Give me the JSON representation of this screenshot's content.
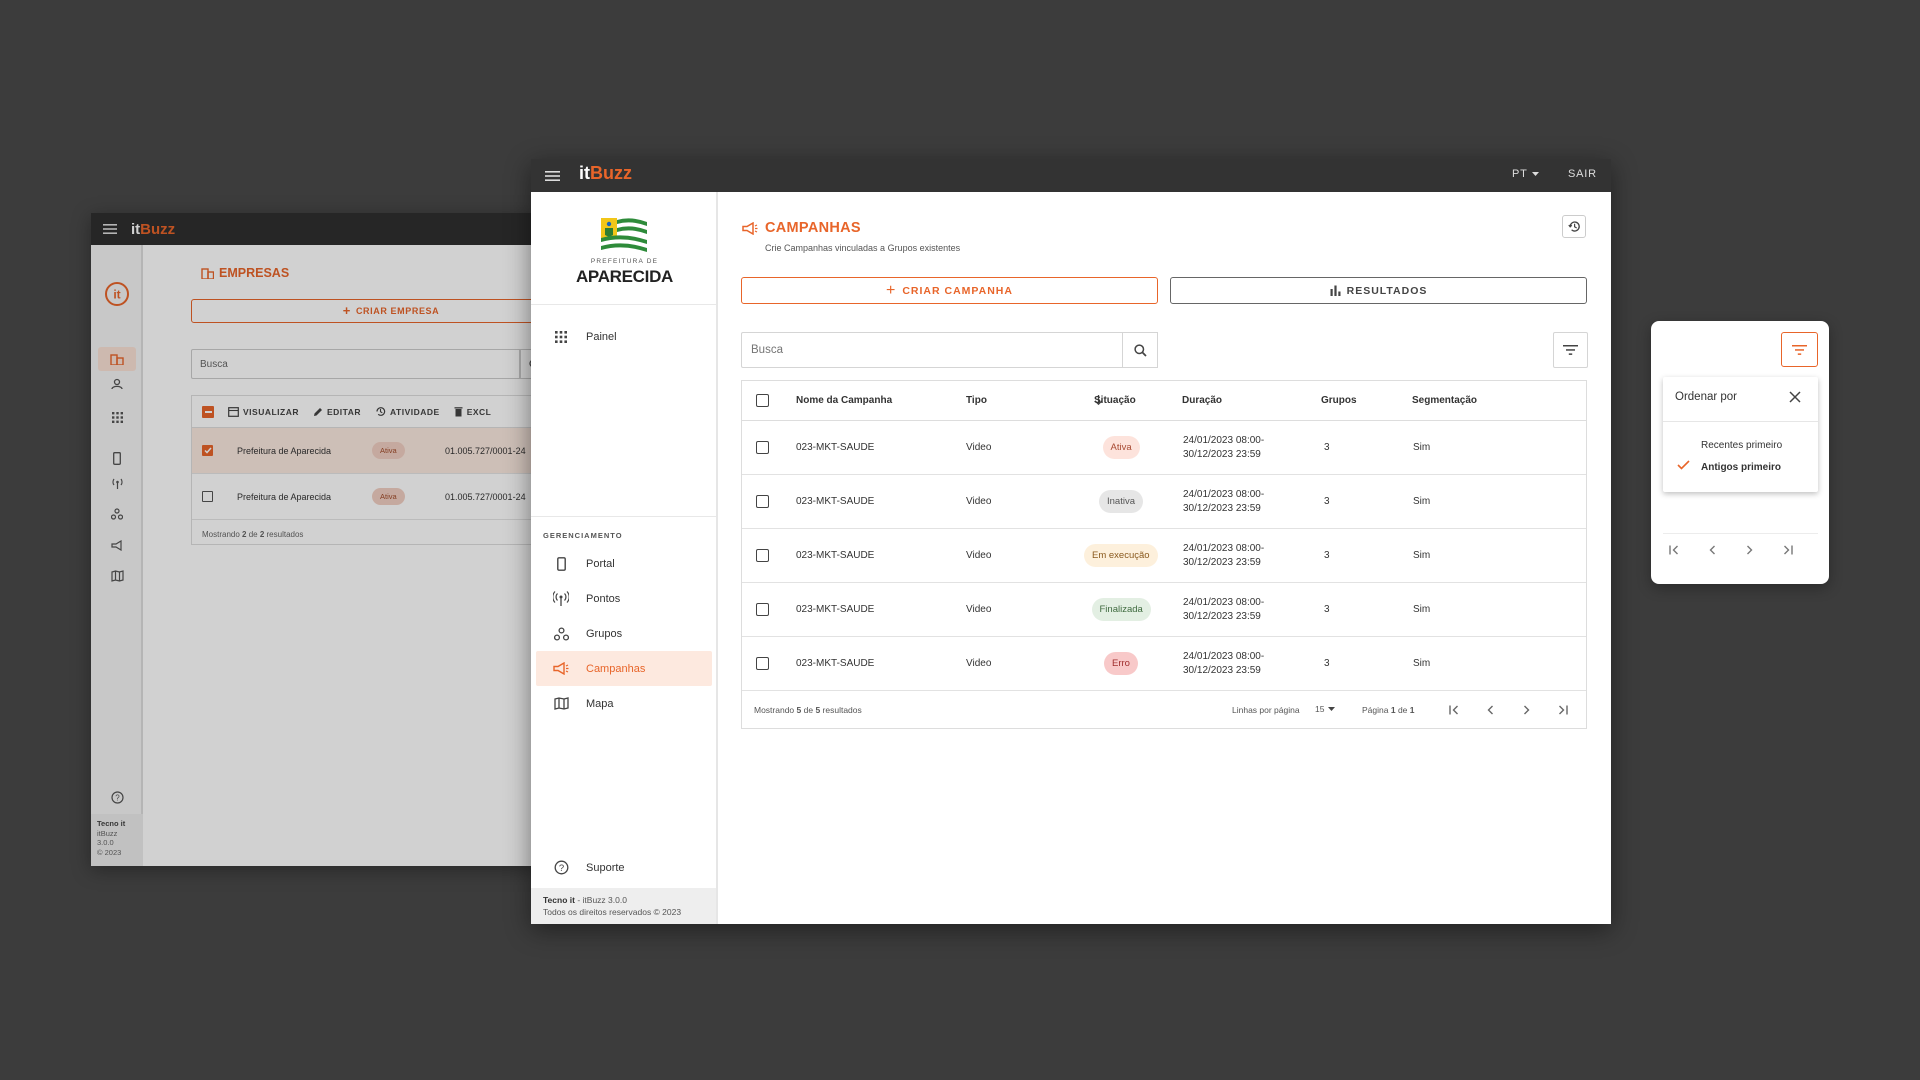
{
  "colors": {
    "accent": "#e8652a",
    "topbar": "#333333",
    "background": "#3c3c3c"
  },
  "brand": {
    "part1": "it",
    "part2": "Buzz"
  },
  "background_window": {
    "title": "EMPRESAS",
    "create_label": "CRIAR EMPRESA",
    "search_placeholder": "Busca",
    "toolbar": {
      "view": "VISUALIZAR",
      "edit": "EDITAR",
      "activity": "ATIVIDADE",
      "delete": "EXCL"
    },
    "rows": [
      {
        "name": "Prefeitura de Aparecida",
        "status": "Ativa",
        "cnpj": "01.005.727/0001-24",
        "selected": true
      },
      {
        "name": "Prefeitura de Aparecida",
        "status": "Ativa",
        "cnpj": "01.005.727/0001-24",
        "selected": false
      }
    ],
    "footer": {
      "prefix": "Mostrando ",
      "shown": "2",
      "mid": " de ",
      "total": "2",
      "suffix": " resultados"
    },
    "rail_footer": {
      "company": "Tecno it",
      "app": "itBuzz",
      "version": "3.0.0",
      "copyright": "© 2023"
    }
  },
  "topbar": {
    "language": "PT",
    "logout": "SAIR"
  },
  "sidebar": {
    "logo_sub": "PREFEITURA DE",
    "logo_name": "APARECIDA",
    "dashboard": "Painel",
    "section_label": "GERENCIAMENTO",
    "items": [
      {
        "label": "Portal",
        "icon": "phone-icon"
      },
      {
        "label": "Pontos",
        "icon": "antenna-icon"
      },
      {
        "label": "Grupos",
        "icon": "groups-icon"
      },
      {
        "label": "Campanhas",
        "icon": "megaphone-icon",
        "active": true
      },
      {
        "label": "Mapa",
        "icon": "map-icon"
      }
    ],
    "support": "Suporte",
    "footer": {
      "company": "Tecno it",
      "app": " - itBuzz 3.0.0",
      "rights": "Todos os direitos reservados © 2023"
    }
  },
  "page": {
    "title": "CAMPANHAS",
    "subtitle": "Crie Campanhas vinculadas a Grupos existentes",
    "create_label": "CRIAR CAMPANHA",
    "results_label": "RESULTADOS",
    "search_placeholder": "Busca"
  },
  "table": {
    "headers": {
      "name": "Nome da Campanha",
      "type": "Tipo",
      "status": "Situação",
      "duration": "Duração",
      "groups": "Grupos",
      "segmentation": "Segmentação"
    },
    "rows": [
      {
        "name": "023-MKT-SAUDE",
        "type": "Video",
        "status": "Ativa",
        "status_color": "#fde3dc",
        "status_text_color": "#a84a33",
        "duration_start": "24/01/2023 08:00-",
        "duration_end": "30/12/2023 23:59",
        "groups": "3",
        "segmentation": "Sim"
      },
      {
        "name": "023-MKT-SAUDE",
        "type": "Video",
        "status": "Inativa",
        "status_color": "#e6e6e6",
        "status_text_color": "#555555",
        "duration_start": "24/01/2023 08:00-",
        "duration_end": "30/12/2023 23:59",
        "groups": "3",
        "segmentation": "Sim"
      },
      {
        "name": "023-MKT-SAUDE",
        "type": "Video",
        "status": "Em execução",
        "status_color": "#fdf0dc",
        "status_text_color": "#8a5a1e",
        "duration_start": "24/01/2023 08:00-",
        "duration_end": "30/12/2023 23:59",
        "groups": "3",
        "segmentation": "Sim"
      },
      {
        "name": "023-MKT-SAUDE",
        "type": "Video",
        "status": "Finalizada",
        "status_color": "#e3efe3",
        "status_text_color": "#3f6a3f",
        "duration_start": "24/01/2023 08:00-",
        "duration_end": "30/12/2023 23:59",
        "groups": "3",
        "segmentation": "Sim"
      },
      {
        "name": "023-MKT-SAUDE",
        "type": "Video",
        "status": "Erro",
        "status_color": "#f8c9c9",
        "status_text_color": "#a12f2f",
        "duration_start": "24/01/2023 08:00-",
        "duration_end": "30/12/2023 23:59",
        "groups": "3",
        "segmentation": "Sim"
      }
    ],
    "footer": {
      "showing_prefix": "Mostrando ",
      "showing": "5",
      "showing_mid": " de ",
      "total": "5",
      "showing_suffix": " resultados",
      "rows_per_page_label": "Linhas por página",
      "rows_per_page": "15",
      "page_prefix": "Página ",
      "page": "1",
      "page_mid": " de ",
      "pages": "1"
    }
  },
  "sort_menu": {
    "title": "Ordenar por",
    "options": [
      {
        "label": "Recentes primeiro",
        "selected": false
      },
      {
        "label": "Antigos primeiro",
        "selected": true
      }
    ]
  }
}
